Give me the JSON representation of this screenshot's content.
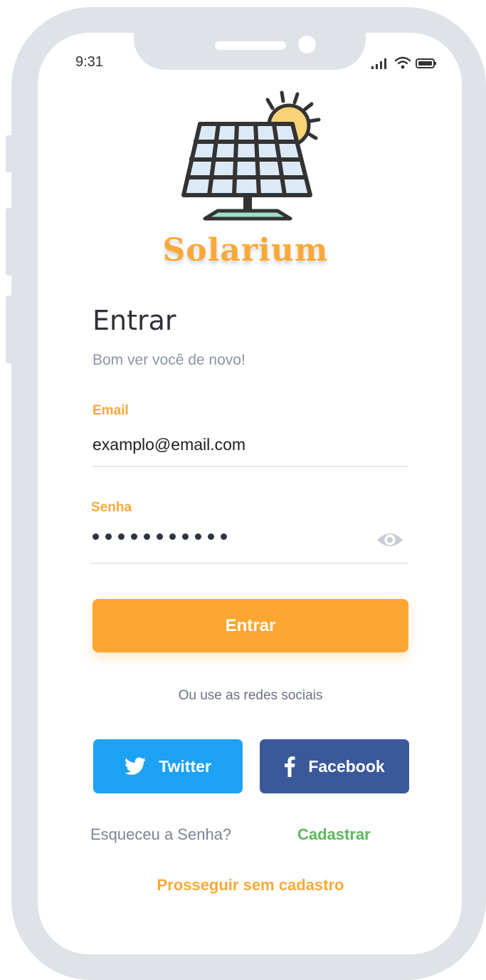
{
  "status_bar": {
    "time": "9:31",
    "icons": [
      "signal-icon",
      "wifi-icon",
      "battery-icon"
    ]
  },
  "brand": {
    "name": "Solarium",
    "logo_icon": "solar-panel-sun-icon",
    "color": "#f9a93a"
  },
  "login": {
    "title": "Entrar",
    "subtitle": "Bom ver você de novo!",
    "email": {
      "label": "Email",
      "value": "examplo@email.com"
    },
    "password": {
      "label": "Senha",
      "masked_length": 11,
      "toggle_icon": "eye-icon"
    },
    "submit_label": "Entrar"
  },
  "social": {
    "caption": "Ou use as redes sociais",
    "twitter_label": "Twitter",
    "facebook_label": "Facebook",
    "twitter_color": "#1da1f2",
    "facebook_color": "#3b5998"
  },
  "links": {
    "forgot": "Esqueceu a Senha?",
    "register": "Cadastrar",
    "skip": "Prosseguir sem cadastro"
  },
  "colors": {
    "accent": "#fea632",
    "register_green": "#5cb85c"
  }
}
